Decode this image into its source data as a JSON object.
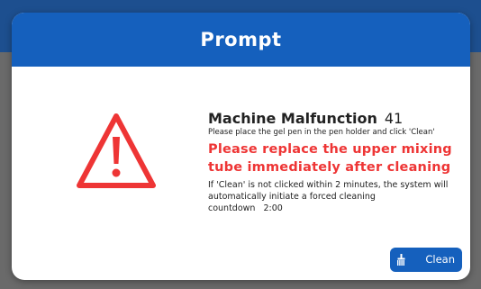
{
  "dialog": {
    "title": "Prompt",
    "heading": "Machine Malfunction",
    "code": "41",
    "instruction": "Please place the gel pen in the pen holder and click 'Clean'",
    "alert": "Please replace the upper mixing tube immediately after cleaning",
    "notice": "If 'Clean' is not clicked within 2 minutes, the system will automatically initiate a forced cleaning",
    "countdown_label": "countdown",
    "countdown_value": "2:00",
    "clean_button": "Clean"
  },
  "icons": {
    "warning": "warning-icon",
    "clean": "broom-icon"
  },
  "colors": {
    "primary": "#1560bd",
    "alert": "#ee3535",
    "text": "#222222"
  }
}
